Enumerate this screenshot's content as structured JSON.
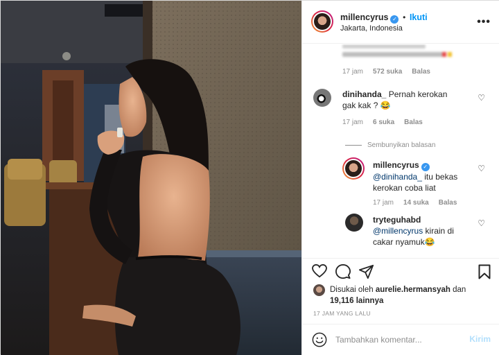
{
  "post": {
    "username": "millencyrus",
    "follow_label": "Ikuti",
    "separator": "•",
    "location": "Jakarta, Indonesia",
    "more_label": "•••"
  },
  "comments": {
    "first": {
      "meta_time": "17 jam",
      "meta_likes": "572 suka",
      "meta_reply": "Balas"
    },
    "second": {
      "username": "dinihanda_",
      "text": "Pernah kerokan gak kak ? 😂",
      "meta_time": "17 jam",
      "meta_likes": "6 suka",
      "meta_reply": "Balas"
    },
    "hide_replies_label": "Sembunyikan balasan",
    "reply1": {
      "username": "millencyrus",
      "mention": "@dinihanda_",
      "text": " itu bekas kerokan coba liat",
      "meta_time": "17 jam",
      "meta_likes": "14 suka",
      "meta_reply": "Balas"
    },
    "reply2": {
      "username": "tryteguhabd",
      "mention": "@millencyrus",
      "text": " kirain di cakar nyamuk😂"
    }
  },
  "likes": {
    "prefix": "Disukai oleh",
    "liker": "aurelie.hermansyah",
    "suffix": "dan",
    "others": "19,116 lainnya",
    "timestamp": "17 JAM YANG LALU"
  },
  "composer": {
    "placeholder": "Tambahkan komentar...",
    "post_label": "Kirim"
  },
  "colors": {
    "accent": "#0095f6",
    "verified": "#3897f0",
    "muted": "#8e8e8e",
    "post_disabled": "#b2dffc"
  }
}
